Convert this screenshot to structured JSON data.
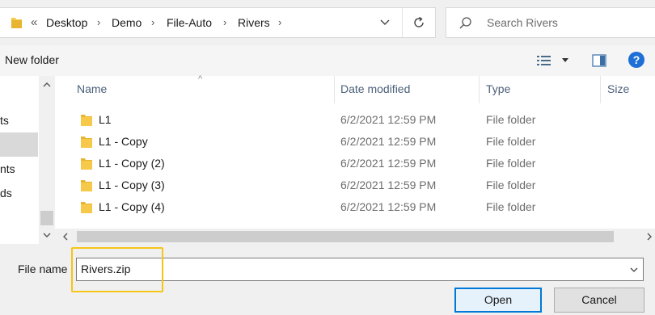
{
  "address": {
    "overflow": "«",
    "crumbs": [
      "Desktop",
      "Demo",
      "File-Auto",
      "Rivers"
    ]
  },
  "search": {
    "placeholder": "Search Rivers"
  },
  "toolbar": {
    "new_folder": "New folder",
    "help": "?"
  },
  "nav": {
    "items": [
      "ts",
      "nts",
      "ds"
    ]
  },
  "columns": [
    "Name",
    "Date modified",
    "Type",
    "Size"
  ],
  "files": [
    {
      "name": "L1",
      "date": "6/2/2021 12:59 PM",
      "type": "File folder"
    },
    {
      "name": "L1 - Copy",
      "date": "6/2/2021 12:59 PM",
      "type": "File folder"
    },
    {
      "name": "L1 - Copy (2)",
      "date": "6/2/2021 12:59 PM",
      "type": "File folder"
    },
    {
      "name": "L1 - Copy (3)",
      "date": "6/2/2021 12:59 PM",
      "type": "File folder"
    },
    {
      "name": "L1 - Copy (4)",
      "date": "6/2/2021 12:59 PM",
      "type": "File folder"
    }
  ],
  "filename": {
    "label": "File name",
    "value": "Rivers.zip"
  },
  "buttons": {
    "open": "Open",
    "cancel": "Cancel"
  },
  "colors": {
    "folder": "#f6c94a",
    "accent": "#0078d7",
    "highlight": "#f5c518"
  }
}
